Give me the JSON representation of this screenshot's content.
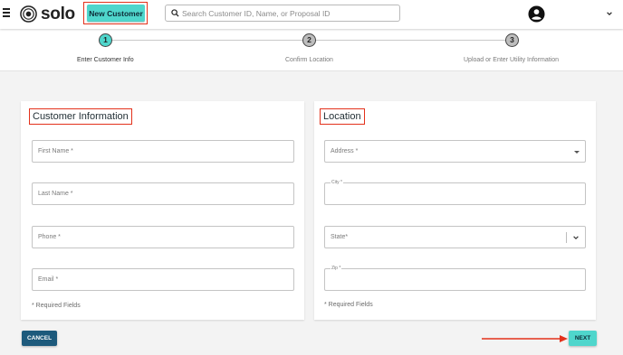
{
  "header": {
    "brand": "solo",
    "new_customer_label": "New Customer",
    "search_placeholder": "Search Customer ID, Name, or Proposal ID",
    "icons": [
      "menu-icon",
      "solo-logo-icon",
      "search-icon",
      "account-icon",
      "chevron-down-icon"
    ]
  },
  "stepper": {
    "steps": [
      {
        "number": "1",
        "label": "Enter Customer Info",
        "active": true
      },
      {
        "number": "2",
        "label": "Confirm Location",
        "active": false
      },
      {
        "number": "3",
        "label": "Upload or Enter Utility Information",
        "active": false
      }
    ]
  },
  "customer_info": {
    "title": "Customer Information",
    "first_name_placeholder": "First Name *",
    "last_name_placeholder": "Last Name *",
    "phone_placeholder": "Phone *",
    "email_placeholder": "Email *",
    "required_note": "* Required Fields"
  },
  "location": {
    "title": "Location",
    "address_placeholder": "Address *",
    "city_label": "City *",
    "state_placeholder": "State*",
    "zip_label": "Zip *",
    "required_note": "* Required Fields"
  },
  "actions": {
    "cancel_label": "CANCEL",
    "next_label": "NEXT"
  },
  "colors": {
    "accent": "#4fd6cc",
    "primary_dark": "#1d5a7c",
    "annotation_red": "#e3311b"
  }
}
